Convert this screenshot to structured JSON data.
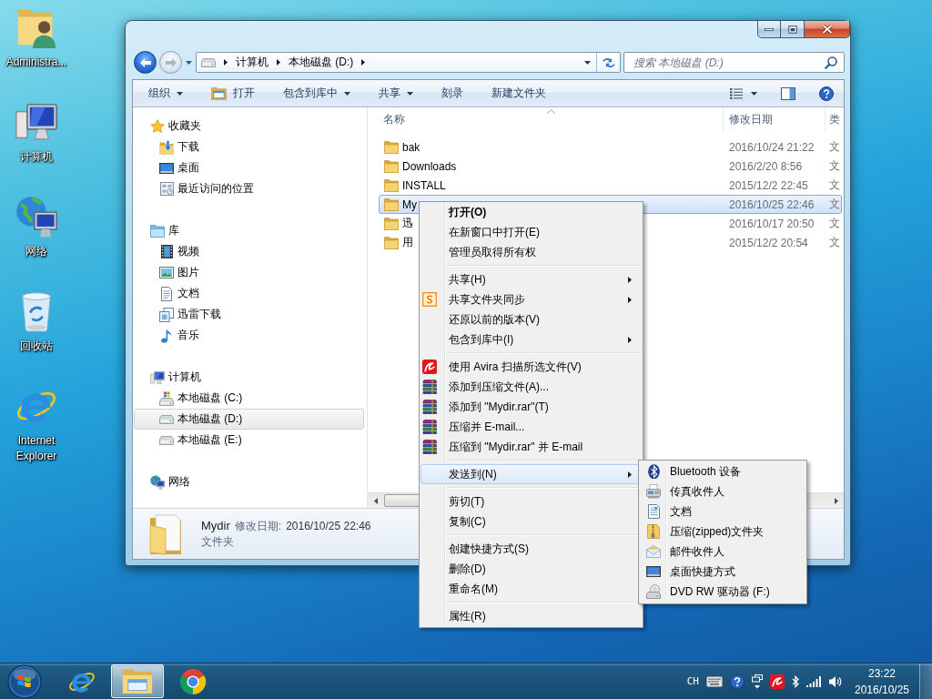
{
  "desktop": {
    "icons": [
      {
        "label": "Administra..."
      },
      {
        "label": "计算机"
      },
      {
        "label": "网络"
      },
      {
        "label": "回收站"
      },
      {
        "label": "Internet Explorer"
      }
    ]
  },
  "window": {
    "address_bar": {
      "segments": [
        "计算机",
        "本地磁盘 (D:)"
      ]
    },
    "search": {
      "placeholder": "搜索 本地磁盘 (D:)"
    },
    "toolbar": {
      "items": [
        {
          "label": "组织",
          "dropdown": true
        },
        {
          "label": "打开",
          "dropdown": false
        },
        {
          "label": "包含到库中",
          "dropdown": true
        },
        {
          "label": "共享",
          "dropdown": true
        },
        {
          "label": "刻录",
          "dropdown": false
        },
        {
          "label": "新建文件夹",
          "dropdown": false
        }
      ]
    },
    "nav": {
      "groups": [
        {
          "label": "收藏夹",
          "selected": false,
          "children": [
            {
              "label": "下载",
              "selected": false
            },
            {
              "label": "桌面",
              "selected": false
            },
            {
              "label": "最近访问的位置",
              "selected": false
            }
          ]
        },
        {
          "label": "库",
          "selected": false,
          "children": [
            {
              "label": "视频",
              "selected": false
            },
            {
              "label": "图片",
              "selected": false
            },
            {
              "label": "文档",
              "selected": false
            },
            {
              "label": "迅雷下载",
              "selected": false
            },
            {
              "label": "音乐",
              "selected": false
            }
          ]
        },
        {
          "label": "计算机",
          "selected": false,
          "children": [
            {
              "label": "本地磁盘 (C:)",
              "selected": false
            },
            {
              "label": "本地磁盘 (D:)",
              "selected": true
            },
            {
              "label": "本地磁盘 (E:)",
              "selected": false
            }
          ]
        },
        {
          "label": "网络",
          "selected": false
        }
      ]
    },
    "file_list": {
      "columns": [
        {
          "label": "名称",
          "sorted": true
        },
        {
          "label": "修改日期",
          "sorted": false
        },
        {
          "label": "类",
          "sorted": false
        }
      ],
      "rows": [
        {
          "name": "bak",
          "date_modified": "2016/10/24 21:22",
          "column_3": "文",
          "selected": false
        },
        {
          "name": "Downloads",
          "date_modified": "2016/2/20 8:56",
          "column_3": "文",
          "selected": false
        },
        {
          "name": "INSTALL",
          "date_modified": "2015/12/2 22:45",
          "column_3": "文",
          "selected": false
        },
        {
          "name": "My",
          "date_modified": "2016/10/25 22:46",
          "column_3": "文",
          "selected": true
        },
        {
          "name": "迅",
          "date_modified": "2016/10/17 20:50",
          "column_3": "文",
          "selected": false
        },
        {
          "name": "用",
          "date_modified": "2015/12/2 20:54",
          "column_3": "文",
          "selected": false
        }
      ]
    },
    "details": {
      "name": "Mydir",
      "date_label": "修改日期:",
      "date_value": "2016/10/25 22:46",
      "item_type": "文件夹"
    }
  },
  "context_menu": {
    "groups": [
      {
        "items": [
          {
            "label": "打开(O)",
            "default": true,
            "submenu": false,
            "selected": false
          },
          {
            "label": "在新窗口中打开(E)",
            "default": false,
            "submenu": false,
            "selected": false
          },
          {
            "label": "管理员取得所有权",
            "default": false,
            "submenu": false,
            "selected": false
          }
        ]
      },
      {
        "items": [
          {
            "label": "共享(H)",
            "default": false,
            "submenu": true,
            "selected": false
          },
          {
            "label": "共享文件夹同步",
            "default": false,
            "submenu": true,
            "selected": false
          },
          {
            "label": "还原以前的版本(V)",
            "default": false,
            "submenu": false,
            "selected": false
          },
          {
            "label": "包含到库中(I)",
            "default": false,
            "submenu": true,
            "selected": false
          }
        ]
      },
      {
        "items": [
          {
            "label": "使用 Avira 扫描所选文件(V)",
            "default": false,
            "submenu": false,
            "selected": false
          },
          {
            "label": "添加到压缩文件(A)...",
            "default": false,
            "submenu": false,
            "selected": false
          },
          {
            "label": "添加到 \"Mydir.rar\"(T)",
            "default": false,
            "submenu": false,
            "selected": false
          },
          {
            "label": "压缩并 E-mail...",
            "default": false,
            "submenu": false,
            "selected": false
          },
          {
            "label": "压缩到 \"Mydir.rar\" 并 E-mail",
            "default": false,
            "submenu": false,
            "selected": false
          }
        ]
      },
      {
        "items": [
          {
            "label": "发送到(N)",
            "default": false,
            "submenu": true,
            "selected": true
          }
        ]
      },
      {
        "items": [
          {
            "label": "剪切(T)",
            "default": false,
            "submenu": false,
            "selected": false
          },
          {
            "label": "复制(C)",
            "default": false,
            "submenu": false,
            "selected": false
          }
        ]
      },
      {
        "items": [
          {
            "label": "创建快捷方式(S)",
            "default": false,
            "submenu": false,
            "selected": false
          },
          {
            "label": "删除(D)",
            "default": false,
            "submenu": false,
            "selected": false
          },
          {
            "label": "重命名(M)",
            "default": false,
            "submenu": false,
            "selected": false
          }
        ]
      },
      {
        "items": [
          {
            "label": "属性(R)",
            "default": false,
            "submenu": false,
            "selected": false
          }
        ]
      }
    ]
  },
  "send_to_menu": {
    "items": [
      {
        "label": "Bluetooth 设备"
      },
      {
        "label": "传真收件人"
      },
      {
        "label": "文档"
      },
      {
        "label": "压缩(zipped)文件夹"
      },
      {
        "label": "邮件收件人"
      },
      {
        "label": "桌面快捷方式"
      },
      {
        "label": "DVD RW 驱动器 (F:)"
      }
    ]
  },
  "taskbar": {
    "apps": [
      {
        "selected": false
      },
      {
        "selected": true
      },
      {
        "selected": false
      }
    ],
    "language": "CH",
    "clock": {
      "time": "23:22",
      "date": "2016/10/25"
    }
  }
}
